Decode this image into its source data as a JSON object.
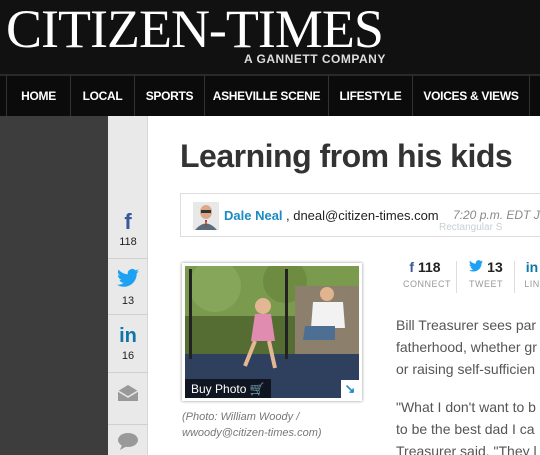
{
  "masthead": {
    "title": "CITIZEN-TIMES",
    "tagline": "A GANNETT COMPANY"
  },
  "nav": {
    "items": [
      {
        "label": "HOME"
      },
      {
        "label": "LOCAL"
      },
      {
        "label": "SPORTS"
      },
      {
        "label": "ASHEVILLE SCENE"
      },
      {
        "label": "LIFESTYLE"
      },
      {
        "label": "VOICES & VIEWS"
      }
    ]
  },
  "sharebar": {
    "facebook": {
      "glyph": "f",
      "count": "118"
    },
    "twitter": {
      "count": "13"
    },
    "linkedin": {
      "glyph": "in",
      "count": "16"
    },
    "icons": [
      "facebook-icon",
      "twitter-icon",
      "linkedin-icon",
      "email-icon",
      "comment-icon"
    ]
  },
  "article": {
    "headline": "Learning from his kids",
    "byline": {
      "author": "Dale Neal",
      "email": ", dneal@citizen-times.com",
      "time": "7:20 p.m. EDT J",
      "tooltip": "Rectangular S"
    },
    "photo": {
      "buy_label": "Buy Photo",
      "caption": "(Photo: William Woody / wwoody@citizen-times.com)"
    },
    "inline_share": {
      "connect": {
        "glyph": "f",
        "count": "118",
        "label": "CONNECT"
      },
      "tweet": {
        "count": "13",
        "label": "TWEET"
      },
      "linkedin": {
        "glyph": "in",
        "label": "LIN"
      }
    },
    "paragraphs": [
      "Bill Treasurer sees par",
      "fatherhood, whether gr",
      "or raising self-sufficien",
      "\"What I don't want to b",
      "to be the best dad I ca",
      "Treasurer said. \"They l"
    ]
  },
  "colors": {
    "brand_blue": "#1a8bc4",
    "facebook_blue": "#3b5998",
    "twitter_blue": "#1da1f2",
    "linkedin_blue": "#0e76a8"
  }
}
